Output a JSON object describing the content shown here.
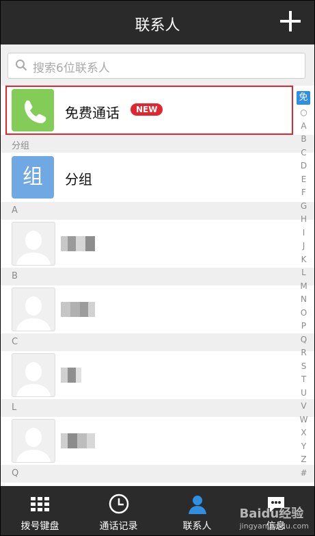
{
  "header": {
    "title": "联系人",
    "add_icon": "plus-icon"
  },
  "search": {
    "placeholder": "搜索6位联系人",
    "icon": "search-icon"
  },
  "free_call": {
    "label": "免费通话",
    "badge": "NEW",
    "icon": "phone-icon"
  },
  "sections": [
    {
      "label": "分组"
    },
    {
      "label": "A"
    },
    {
      "label": "B"
    },
    {
      "label": "C"
    },
    {
      "label": "L"
    },
    {
      "label": "Q"
    }
  ],
  "group_row": {
    "tile": "组",
    "label": "分组"
  },
  "index_bar": {
    "first": "免",
    "items": [
      "○",
      "A",
      "B",
      "C",
      "D",
      "E",
      "F",
      "G",
      "H",
      "I",
      "J",
      "K",
      "L",
      "M",
      "N",
      "O",
      "P",
      "Q",
      "R",
      "S",
      "T",
      "U",
      "V",
      "W",
      "X",
      "Y",
      "Z",
      "#"
    ]
  },
  "tabs": [
    {
      "label": "拨号键盘",
      "icon": "dialpad-icon"
    },
    {
      "label": "通话记录",
      "icon": "clock-icon"
    },
    {
      "label": "联系人",
      "icon": "person-icon"
    },
    {
      "label": "信息",
      "icon": "message-icon"
    }
  ],
  "watermark": {
    "text": "Baidu经验",
    "sub": "jingyan.baidu.com"
  },
  "colors": {
    "accent_green": "#82cc57",
    "accent_blue": "#6fa8e2",
    "highlight_red": "#e5262f",
    "index_blue": "#2f8fe0",
    "bar": "#2a2a2a"
  }
}
